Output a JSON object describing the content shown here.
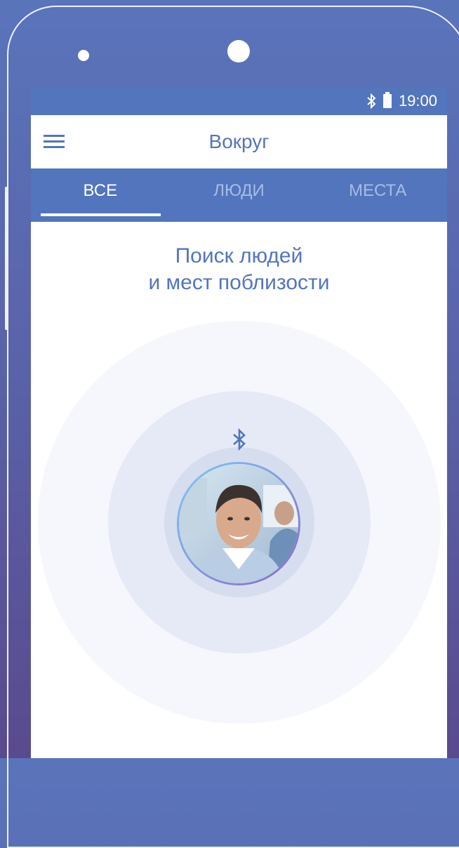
{
  "status_bar": {
    "time": "19:00",
    "icons": [
      "bluetooth-icon",
      "battery-icon"
    ]
  },
  "app_bar": {
    "title": "Вокруг",
    "menu_icon": "menu-icon"
  },
  "tabs": [
    {
      "label": "ВСЕ",
      "active": true
    },
    {
      "label": "ЛЮДИ",
      "active": false
    },
    {
      "label": "МЕСТА",
      "active": false
    }
  ],
  "main": {
    "headline_line1": "Поиск людей",
    "headline_line2": "и мест поблизости",
    "scan_icon": "bluetooth-icon",
    "avatar_icon": "user-photo"
  },
  "colors": {
    "accent": "#5275bd",
    "tab_inactive": "#a7bbe6",
    "background_top": "#5a74bb",
    "background_bottom": "#5a4a8e"
  }
}
